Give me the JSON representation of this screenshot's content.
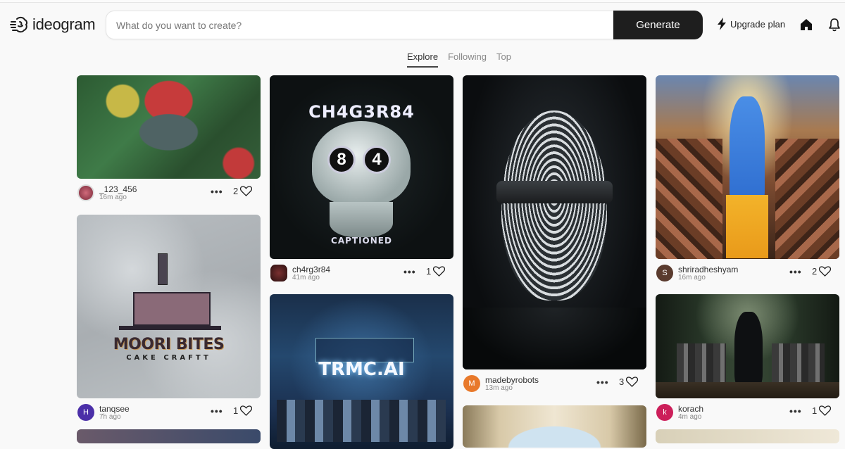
{
  "app": {
    "name": "ideogram"
  },
  "search": {
    "placeholder": "What do you want to create?",
    "value": ""
  },
  "header": {
    "generate_label": "Generate",
    "upgrade_label": "Upgrade plan"
  },
  "tabs": [
    {
      "label": "Explore",
      "active": true
    },
    {
      "label": "Following",
      "active": false
    },
    {
      "label": "Top",
      "active": false
    }
  ],
  "feed": [
    {
      "user": "_123_456",
      "time": "16m ago",
      "likes": "2",
      "avatar_letter": "",
      "avatar_color": "#b0455a",
      "image": "buddha-statue-with-strawberry-leaves"
    },
    {
      "user": "tanqsee",
      "time": "7h ago",
      "likes": "1",
      "avatar_letter": "H",
      "avatar_color": "#4b2fa8",
      "image": "moori-bites-logo",
      "image_title": "MOORI BITES",
      "image_subtitle": "CAKE CRAFTT"
    },
    {
      "user": "ch4rg3r84",
      "time": "41m ago",
      "likes": "1",
      "avatar_letter": "",
      "avatar_color": "#5a2a2a",
      "image": "skull-with-glasses",
      "image_title": "CH4G3R84",
      "image_subtitle": "CAPTIONED",
      "lens_left": "8",
      "lens_right": "4"
    },
    {
      "user": "",
      "time": "",
      "likes": "",
      "image": "trmc-ai-trading-floor",
      "image_title": "TRMC.AI"
    },
    {
      "user": "madebyrobots",
      "time": "13m ago",
      "likes": "3",
      "avatar_letter": "M",
      "avatar_color": "#e8792b",
      "image": "blindfolded-fingerprint-face"
    },
    {
      "user": "",
      "time": "",
      "likes": "",
      "image": "archway-courtyard"
    },
    {
      "user": "shriradheshyam",
      "time": "16m ago",
      "likes": "2",
      "avatar_letter": "S",
      "avatar_color": "#5a3b2e",
      "image": "lord-rama-with-crowd"
    },
    {
      "user": "korach",
      "time": "4m ago",
      "likes": "1",
      "avatar_letter": "k",
      "avatar_color": "#cc1f5a",
      "image": "wolves-in-forest"
    }
  ]
}
